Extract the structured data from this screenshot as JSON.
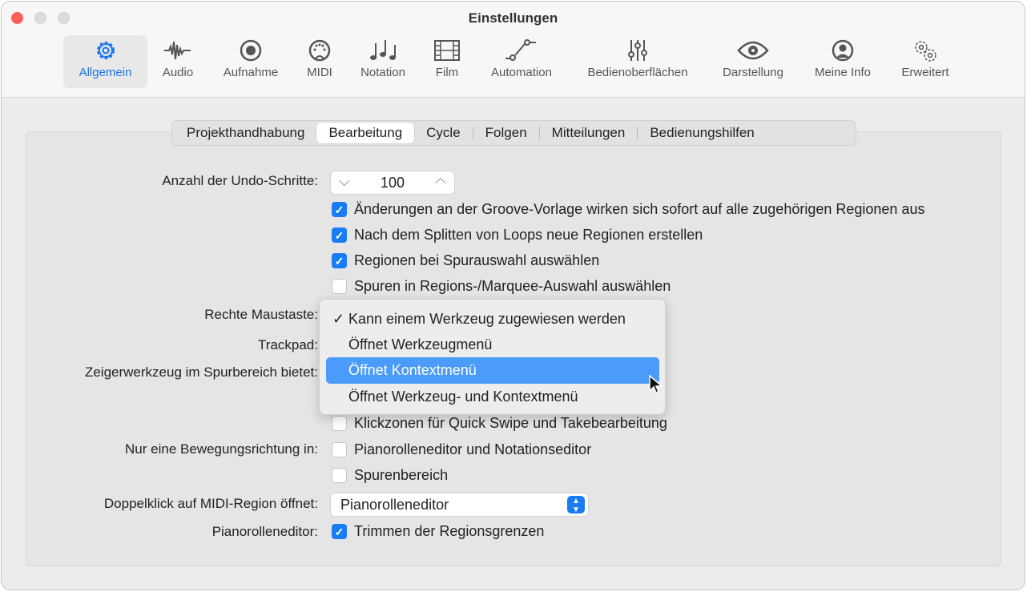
{
  "window": {
    "title": "Einstellungen"
  },
  "toolbar": {
    "items": [
      {
        "label": "Allgemein",
        "icon": "gear-icon",
        "selected": true
      },
      {
        "label": "Audio",
        "icon": "waveform-icon"
      },
      {
        "label": "Aufnahme",
        "icon": "record-icon"
      },
      {
        "label": "MIDI",
        "icon": "midi-port-icon"
      },
      {
        "label": "Notation",
        "icon": "notes-icon"
      },
      {
        "label": "Film",
        "icon": "film-icon"
      },
      {
        "label": "Automation",
        "icon": "automation-icon"
      },
      {
        "label": "Bedienoberflächen",
        "icon": "sliders-icon"
      },
      {
        "label": "Darstellung",
        "icon": "eye-icon"
      },
      {
        "label": "Meine Info",
        "icon": "person-icon"
      },
      {
        "label": "Erweitert",
        "icon": "gears-icon"
      }
    ]
  },
  "tabs": [
    "Projekthandhabung",
    "Bearbeitung",
    "Cycle",
    "Folgen",
    "Mitteilungen",
    "Bedienungshilfen"
  ],
  "selected_tab": "Bearbeitung",
  "form": {
    "undo_label": "Anzahl der Undo-Schritte:",
    "undo_value": "100",
    "cb1": "Änderungen an der Groove-Vorlage wirken sich sofort auf alle zugehörigen Regionen aus",
    "cb1_checked": true,
    "cb2": "Nach dem Splitten von Loops neue Regionen erstellen",
    "cb2_checked": true,
    "cb3": "Regionen bei Spurauswahl auswählen",
    "cb3_checked": true,
    "cb4": "Spuren in Regions-/Marquee-Auswahl auswählen",
    "cb4_checked": false,
    "right_mouse_label": "Rechte Maustaste:",
    "trackpad_label": "Trackpad:",
    "pointer_label": "Zeigerwerkzeug im Spurbereich bietet:",
    "cb5": "Klickzonen für Quick Swipe und Takebearbeitung",
    "cb5_checked": false,
    "one_dir_label": "Nur eine Bewegungsrichtung in:",
    "cb6": "Pianorolleneditor und Notationseditor",
    "cb6_checked": false,
    "cb7": "Spurenbereich",
    "cb7_checked": false,
    "dblclick_label": "Doppelklick auf MIDI-Region öffnet:",
    "dblclick_value": "Pianorolleneditor",
    "piano_label": "Pianorolleneditor:",
    "cb8": "Trimmen der Regionsgrenzen",
    "cb8_checked": true
  },
  "menu": {
    "items": [
      "Kann einem Werkzeug zugewiesen werden",
      "Öffnet Werkzeugmenü",
      "Öffnet Kontextmenü",
      "Öffnet Werkzeug- und Kontextmenü"
    ],
    "checked": "Kann einem Werkzeug zugewiesen werden",
    "highlighted": "Öffnet Kontextmenü"
  },
  "colors": {
    "accent": "#1a7cf5",
    "highlight": "#4b9cfa",
    "close": "#fe5f57"
  }
}
